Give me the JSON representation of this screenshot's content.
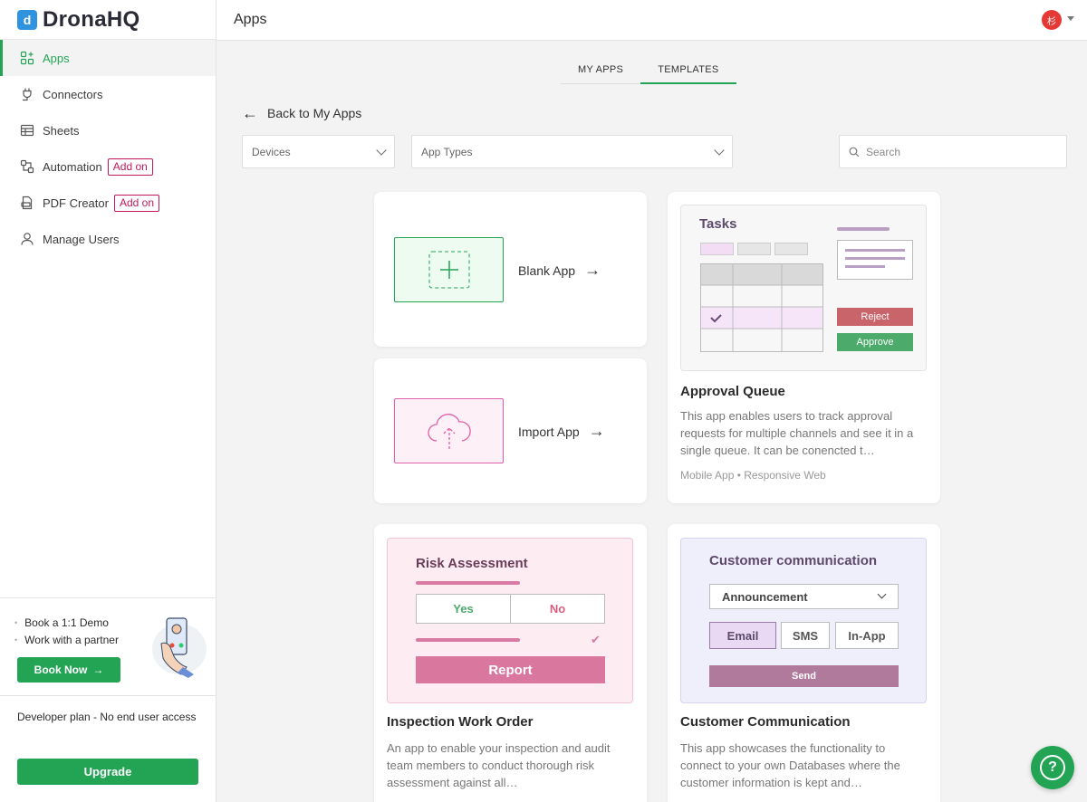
{
  "app": {
    "name": "DronaHQ"
  },
  "header": {
    "title": "Apps",
    "avatar_text": "杉"
  },
  "sidebar": {
    "items": [
      {
        "label": "Apps",
        "icon": "apps-grid-icon",
        "active": true
      },
      {
        "label": "Connectors",
        "icon": "plug-icon"
      },
      {
        "label": "Sheets",
        "icon": "table-icon"
      },
      {
        "label": "Automation",
        "icon": "automation-icon",
        "badge": "Add on"
      },
      {
        "label": "PDF Creator",
        "icon": "pdf-icon",
        "badge": "Add on"
      },
      {
        "label": "Manage Users",
        "icon": "user-icon"
      }
    ],
    "promo": {
      "bullets": [
        "Book a 1:1 Demo",
        "Work with a partner"
      ],
      "button": "Book Now"
    },
    "plan": {
      "text": "Developer plan - No end user access",
      "button": "Upgrade"
    }
  },
  "tabs": [
    "MY APPS",
    "TEMPLATES"
  ],
  "active_tab": "TEMPLATES",
  "back_link": "Back to My Apps",
  "filters": {
    "devices_placeholder": "Devices",
    "app_types_placeholder": "App Types",
    "search_placeholder": "Search"
  },
  "cards": {
    "blank": {
      "label": "Blank App"
    },
    "import": {
      "label": "Import App"
    },
    "approval": {
      "title": "Approval Queue",
      "description": "This app enables users to track approval requests for multiple channels and see it in a single queue. It can be conencted t…",
      "tags": "Mobile App • Responsive Web",
      "thumb": {
        "heading": "Tasks",
        "reject": "Reject",
        "approve": "Approve"
      }
    },
    "inspection": {
      "title": "Inspection Work Order",
      "description": "An app to enable your inspection and audit team members to conduct thorough risk assessment against all…",
      "thumb": {
        "heading": "Risk Assessment",
        "yes": "Yes",
        "no": "No",
        "report": "Report"
      }
    },
    "customer": {
      "title": "Customer Communication",
      "description": "This app showcases the functionality to connect to your own Databases where the customer information is kept and…",
      "thumb": {
        "heading": "Customer communication",
        "select": "Announcement",
        "email": "Email",
        "sms": "SMS",
        "inapp": "In-App",
        "send": "Send"
      }
    }
  },
  "colors": {
    "accent": "#23a455",
    "addon": "#c2185b"
  }
}
